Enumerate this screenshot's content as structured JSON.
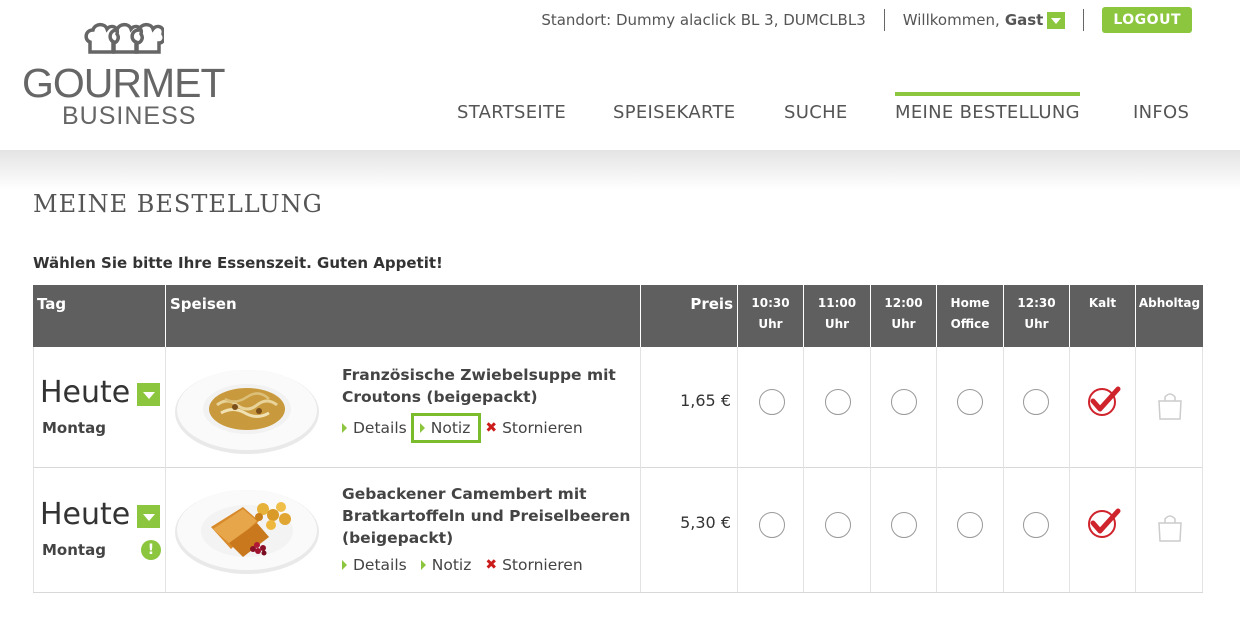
{
  "header": {
    "logo_main": "GOURMET",
    "logo_sub": "BUSINESS",
    "standort": "Standort: Dummy alaclick BL 3, DUMCLBL3",
    "welcome": "Willkommen,",
    "user": "Gast",
    "logout": "LOGOUT"
  },
  "nav": {
    "items": [
      "STARTSEITE",
      "SPEISEKARTE",
      "SUCHE",
      "MEINE BESTELLUNG",
      "INFOS"
    ],
    "active": "MEINE BESTELLUNG"
  },
  "page": {
    "title": "MEINE BESTELLUNG",
    "subtitle": "Wählen Sie bitte Ihre Essenszeit. Guten Appetit!"
  },
  "table": {
    "headers": {
      "tag": "Tag",
      "speisen": "Speisen",
      "preis": "Preis",
      "slots": [
        {
          "l1": "10:30",
          "l2": "Uhr"
        },
        {
          "l1": "11:00",
          "l2": "Uhr"
        },
        {
          "l1": "12:00",
          "l2": "Uhr"
        },
        {
          "l1": "Home",
          "l2": "Office"
        },
        {
          "l1": "12:30",
          "l2": "Uhr"
        }
      ],
      "kalt": "Kalt",
      "abholtag": "Abholtag"
    },
    "rows": [
      {
        "day": "Heute",
        "weekday": "Montag",
        "dish": "Französische Zwiebelsuppe mit Croutons (beigepackt)",
        "price": "1,65 €",
        "kalt_checked": true,
        "warning": false,
        "notiz_highlighted": true
      },
      {
        "day": "Heute",
        "weekday": "Montag",
        "dish": "Gebackener Camembert mit Bratkartoffeln und Preiselbeeren (beigepackt)",
        "price": "5,30 €",
        "kalt_checked": true,
        "warning": true,
        "notiz_highlighted": false
      }
    ],
    "links": {
      "details": "Details",
      "notiz": "Notiz",
      "stornieren": "Stornieren"
    }
  },
  "colors": {
    "accent": "#8cc63f",
    "header_bg": "#5f5f5f",
    "cancel": "#cc1b1b",
    "check": "#d0242c"
  },
  "icons": [
    "chef-hats-logo",
    "dropdown-arrow-icon",
    "warning-icon",
    "checkmark-icon",
    "shopping-bag-icon",
    "cancel-x-icon"
  ]
}
